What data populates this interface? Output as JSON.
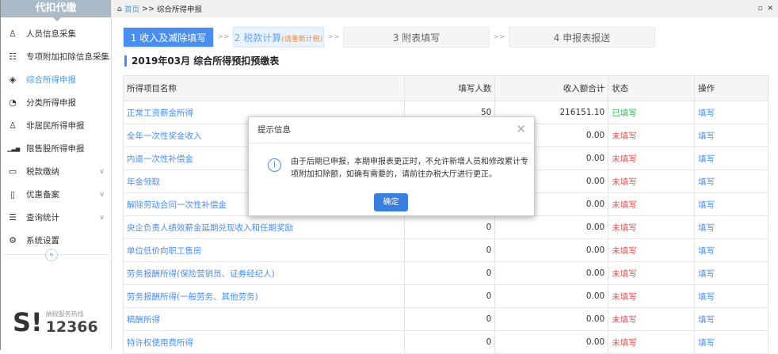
{
  "sidebar": {
    "title": "代扣代缴",
    "items": [
      {
        "label": "人员信息采集",
        "icon": "person-icon",
        "chev": false
      },
      {
        "label": "专项附加扣除信息采集",
        "icon": "list-icon",
        "chev": true
      },
      {
        "label": "综合所得申报",
        "icon": "layers-icon",
        "chev": false,
        "active": true
      },
      {
        "label": "分类所得申报",
        "icon": "pie-chart-icon",
        "chev": false
      },
      {
        "label": "非居民所得申报",
        "icon": "user-icon",
        "chev": false
      },
      {
        "label": "限售股所得申报",
        "icon": "bar-chart-icon",
        "chev": false
      },
      {
        "label": "税款缴纳",
        "icon": "folder-icon",
        "chev": true
      },
      {
        "label": "优惠备案",
        "icon": "book-icon",
        "chev": true
      },
      {
        "label": "查询统计",
        "icon": "search-list-icon",
        "chev": true
      },
      {
        "label": "系统设置",
        "icon": "gear-icon",
        "chev": false
      }
    ],
    "collapse": "«",
    "hotline_label": "纳税服务热线",
    "hotline_number": "12366"
  },
  "breadcrumb": {
    "home": "首页",
    "sep": ">>",
    "current": "综合所得申报"
  },
  "steps": [
    {
      "label": "1 收入及减除填写"
    },
    {
      "label": "2 税款计算",
      "note": "(请重新计税)"
    },
    {
      "label": "3 附表填写"
    },
    {
      "label": "4 申报表报送"
    }
  ],
  "step_sep": ">>",
  "page_title": "2019年03月  综合所得预扣预缴表",
  "table": {
    "headers": [
      "所得项目名称",
      "填写人数",
      "收入额合计",
      "状态",
      "操作"
    ],
    "rows": [
      [
        "正常工资薪金所得",
        "50",
        "216151.10",
        "已填写",
        "填写"
      ],
      [
        "全年一次性奖金收入",
        "",
        "0.00",
        "未填写",
        "填写"
      ],
      [
        "内退一次性补偿金",
        "",
        "0.00",
        "未填写",
        "填写"
      ],
      [
        "年金领取",
        "",
        "0.00",
        "未填写",
        "填写"
      ],
      [
        "解除劳动合同一次性补偿金",
        "",
        "0.00",
        "未填写",
        "填写"
      ],
      [
        "央企负责人绩效薪金延期兑现收入和任期奖励",
        "0",
        "0.00",
        "未填写",
        "填写"
      ],
      [
        "单位低价向职工售房",
        "0",
        "0.00",
        "未填写",
        "填写"
      ],
      [
        "劳务报酬所得(保险营销员、证券经纪人)",
        "0",
        "0.00",
        "未填写",
        "填写"
      ],
      [
        "劳务报酬所得(一般劳务、其他劳务)",
        "0",
        "0.00",
        "未填写",
        "填写"
      ],
      [
        "稿酬所得",
        "0",
        "0.00",
        "未填写",
        "填写"
      ],
      [
        "特许权使用费所得",
        "0",
        "0.00",
        "未填写",
        "填写"
      ]
    ]
  },
  "modal": {
    "title": "提示信息",
    "message": "由于后期已申报，本期申报表更正时，不允许新增人员和修改累计专项附加扣除额，如确有需要的，请前往办税大厅进行更正。",
    "ok": "确定"
  },
  "colors": {
    "accent": "#4a8ef0",
    "filled": "#3cba5c",
    "unfilled": "#f05050"
  }
}
